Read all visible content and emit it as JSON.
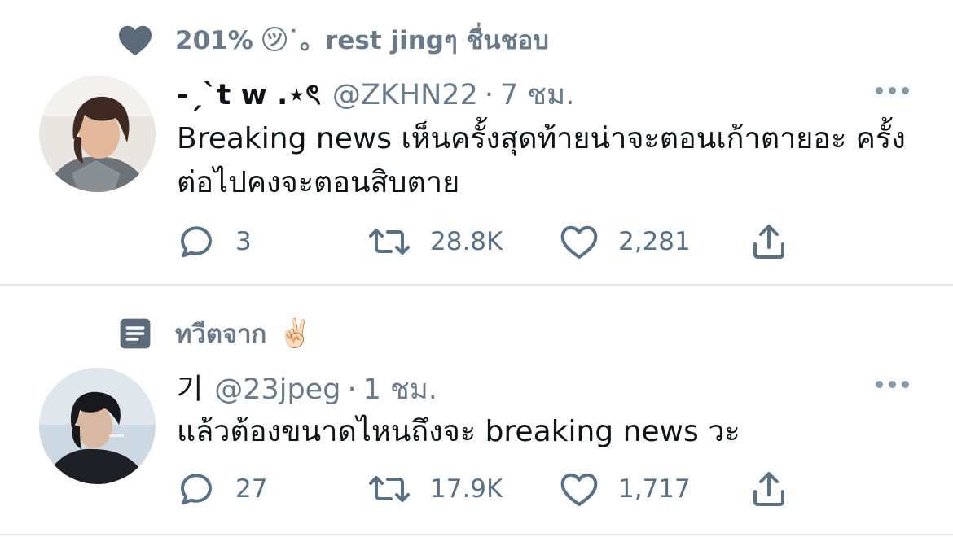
{
  "tweets": [
    {
      "context": {
        "icon": "heart-icon",
        "text": "201% ㋡˙。rest jingๆ ชื่นชอบ",
        "emoji": ""
      },
      "display_name": "-ˏˋt w .⋆ৎ",
      "handle": "@ZKHN22",
      "separator": "·",
      "time": "7 ชม.",
      "text": "Breaking news เห็นครั้งสุดท้ายน่าจะตอนเก้าตายอะ ครั้งต่อไปคงจะตอนสิบตาย",
      "replies": "3",
      "retweets": "28.8K",
      "likes": "2,281"
    },
    {
      "context": {
        "icon": "document-icon",
        "text": "ทวีตจาก",
        "emoji": "✌🏻"
      },
      "display_name": "기",
      "handle": "@23jpeg",
      "separator": "·",
      "time": "1 ชม.",
      "text": "แล้วต้องขนาดไหนถึงจะ breaking news วะ",
      "replies": "27",
      "retweets": "17.9K",
      "likes": "1,717"
    }
  ],
  "colors": {
    "secondary": "#6b7a88",
    "icon": "#5b7083",
    "divider": "#e4e8ec"
  }
}
